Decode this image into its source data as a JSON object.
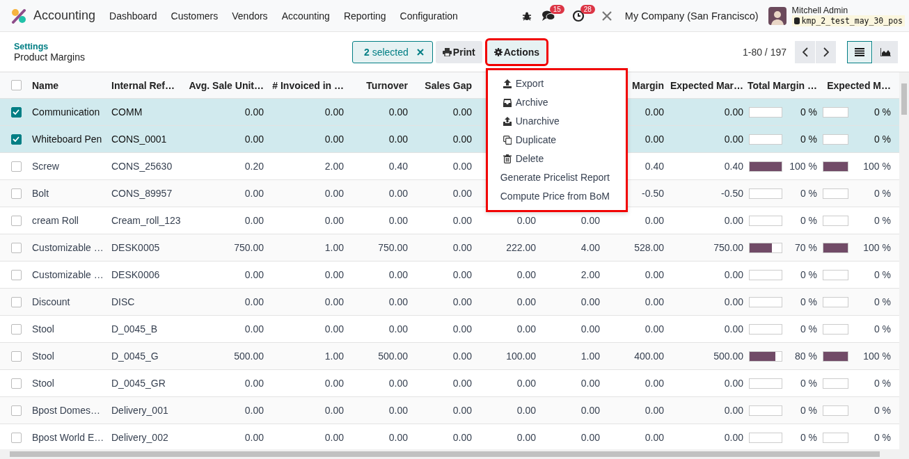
{
  "navbar": {
    "app_name": "Accounting",
    "menu": [
      "Dashboard",
      "Customers",
      "Vendors",
      "Accounting",
      "Reporting",
      "Configuration"
    ],
    "messages_count": "15",
    "activities_count": "28",
    "company": "My Company (San Francisco)",
    "user_name": "Mitchell Admin",
    "database": "kmp_2_test_may_30_pos"
  },
  "control_panel": {
    "breadcrumb_parent": "Settings",
    "title": "Product Margins",
    "selection": {
      "count": "2",
      "label": "selected"
    },
    "print_label": "Print",
    "actions_label": "Actions",
    "actions_open": true,
    "pager": "1-80 / 197",
    "views": [
      {
        "kind": "list",
        "selected": true
      },
      {
        "kind": "graph",
        "selected": false
      }
    ]
  },
  "actions_menu": [
    {
      "kind": "export",
      "label": "Export"
    },
    {
      "kind": "archive",
      "label": "Archive"
    },
    {
      "kind": "unarchive",
      "label": "Unarchive"
    },
    {
      "kind": "duplicate",
      "label": "Duplicate"
    },
    {
      "kind": "delete",
      "label": "Delete"
    },
    {
      "kind": "plain",
      "label": "Generate Pricelist Report"
    },
    {
      "kind": "plain",
      "label": "Compute Price from BoM"
    }
  ],
  "table": {
    "all_selected": false,
    "columns": [
      "Name",
      "Internal Ref…",
      "Avg. Sale Unit…",
      "# Invoiced in …",
      "Turnover",
      "Sales Gap",
      null,
      null,
      "Margin",
      "Expected Mar…",
      "Total Margin …",
      "Expected M…"
    ],
    "rows": [
      {
        "selected": true,
        "cells": [
          "Communication",
          "COMM",
          "0.00",
          "0.00",
          "0.00",
          "0.00",
          null,
          null,
          "0.00",
          "0.00",
          {
            "level": 0,
            "reading": "0 %"
          },
          {
            "level": 0,
            "reading": "0 %"
          }
        ]
      },
      {
        "selected": true,
        "cells": [
          "Whiteboard Pen",
          "CONS_0001",
          "0.00",
          "0.00",
          "0.00",
          "0.00",
          null,
          null,
          "0.00",
          "0.00",
          {
            "level": 0,
            "reading": "0 %"
          },
          {
            "level": 0,
            "reading": "0 %"
          }
        ]
      },
      {
        "selected": false,
        "cells": [
          "Screw",
          "CONS_25630",
          "0.20",
          "2.00",
          "0.40",
          "0.00",
          null,
          null,
          "0.40",
          "0.40",
          {
            "level": 1,
            "reading": "100 %"
          },
          {
            "level": 1,
            "reading": "100 %"
          }
        ]
      },
      {
        "selected": false,
        "cells": [
          "Bolt",
          "CONS_89957",
          "0.00",
          "0.00",
          "0.00",
          "0.00",
          null,
          null,
          "-0.50",
          "-0.50",
          {
            "level": 0,
            "reading": "0 %"
          },
          {
            "level": 0,
            "reading": "0 %"
          }
        ]
      },
      {
        "selected": false,
        "cells": [
          "cream Roll",
          "Cream_roll_123",
          "0.00",
          "0.00",
          "0.00",
          "0.00",
          "0.00",
          "0.00",
          "0.00",
          "0.00",
          {
            "level": 0,
            "reading": "0 %"
          },
          {
            "level": 0,
            "reading": "0 %"
          }
        ]
      },
      {
        "selected": false,
        "cells": [
          "Customizable …",
          "DESK0005",
          "750.00",
          "1.00",
          "750.00",
          "0.00",
          "222.00",
          "4.00",
          "528.00",
          "750.00",
          {
            "level": 0.7,
            "reading": "70 %"
          },
          {
            "level": 1,
            "reading": "100 %"
          }
        ]
      },
      {
        "selected": false,
        "cells": [
          "Customizable …",
          "DESK0006",
          "0.00",
          "0.00",
          "0.00",
          "0.00",
          "0.00",
          "2.00",
          "0.00",
          "0.00",
          {
            "level": 0,
            "reading": "0 %"
          },
          {
            "level": 0,
            "reading": "0 %"
          }
        ]
      },
      {
        "selected": false,
        "cells": [
          "Discount",
          "DISC",
          "0.00",
          "0.00",
          "0.00",
          "0.00",
          "0.00",
          "0.00",
          "0.00",
          "0.00",
          {
            "level": 0,
            "reading": "0 %"
          },
          {
            "level": 0,
            "reading": "0 %"
          }
        ]
      },
      {
        "selected": false,
        "cells": [
          "Stool",
          "D_0045_B",
          "0.00",
          "0.00",
          "0.00",
          "0.00",
          "0.00",
          "0.00",
          "0.00",
          "0.00",
          {
            "level": 0,
            "reading": "0 %"
          },
          {
            "level": 0,
            "reading": "0 %"
          }
        ]
      },
      {
        "selected": false,
        "cells": [
          "Stool",
          "D_0045_G",
          "500.00",
          "1.00",
          "500.00",
          "0.00",
          "100.00",
          "1.00",
          "400.00",
          "500.00",
          {
            "level": 0.8,
            "reading": "80 %"
          },
          {
            "level": 1,
            "reading": "100 %"
          }
        ]
      },
      {
        "selected": false,
        "cells": [
          "Stool",
          "D_0045_GR",
          "0.00",
          "0.00",
          "0.00",
          "0.00",
          "0.00",
          "0.00",
          "0.00",
          "0.00",
          {
            "level": 0,
            "reading": "0 %"
          },
          {
            "level": 0,
            "reading": "0 %"
          }
        ]
      },
      {
        "selected": false,
        "cells": [
          "Bpost Domes…",
          "Delivery_001",
          "0.00",
          "0.00",
          "0.00",
          "0.00",
          "0.00",
          "0.00",
          "0.00",
          "0.00",
          {
            "level": 0,
            "reading": "0 %"
          },
          {
            "level": 0,
            "reading": "0 %"
          }
        ]
      },
      {
        "selected": false,
        "cells": [
          "Bpost World E…",
          "Delivery_002",
          "0.00",
          "0.00",
          "0.00",
          "0.00",
          "0.00",
          "0.00",
          "0.00",
          "0.00",
          {
            "level": 0,
            "reading": "0 %"
          },
          {
            "level": 0,
            "reading": "0 %"
          }
        ]
      }
    ]
  }
}
